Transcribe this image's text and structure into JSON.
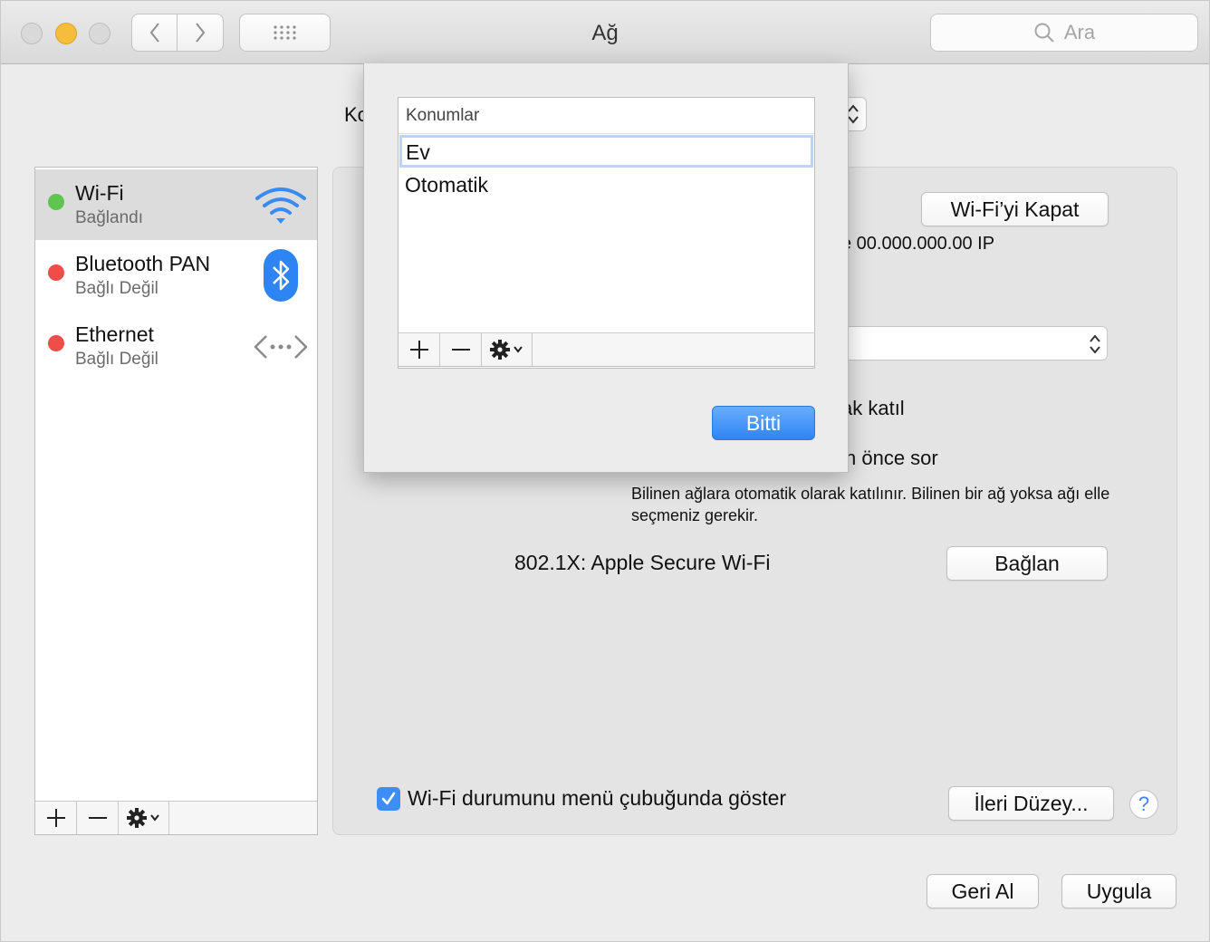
{
  "window": {
    "title": "Ağ"
  },
  "toolbar": {
    "search_placeholder": "Ara"
  },
  "location": {
    "label_visible": "Ko"
  },
  "services": [
    {
      "name": "Wi-Fi",
      "status": "Bağlandı",
      "status_color": "#5fc550",
      "icon": "wifi-icon",
      "selected": true
    },
    {
      "name": "Bluetooth PAN",
      "status": "Bağlı Değil",
      "status_color": "#ee4d49",
      "icon": "bluetooth-icon",
      "selected": false
    },
    {
      "name": "Ethernet",
      "status": "Bağlı Değil",
      "status_color": "#ee4d49",
      "icon": "ethernet-icon",
      "selected": false
    }
  ],
  "panel": {
    "wifi_off_button": "Wi-Fi’yi Kapat",
    "ip_text": "e 00.000.000.00 IP",
    "auto_join_fragment": "ak katıl",
    "ask_fragment": "n önce sor",
    "description": "Bilinen ağlara otomatik olarak katılınır. Bilinen bir ağ yoksa ağı elle seçmeniz gerekir.",
    "dot1x_label": "802.1X:  Apple Secure Wi-Fi",
    "connect_button": "Bağlan",
    "show_status_label": "Wi-Fi durumunu menü çubuğunda göster",
    "show_status_checked": true,
    "advanced_button": "İleri Düzey...",
    "help": "?"
  },
  "footer": {
    "revert_button": "Geri Al",
    "apply_button": "Uygula"
  },
  "sheet": {
    "header": "Konumlar",
    "locations": [
      "Ev",
      "Otomatik"
    ],
    "selected_location": "Ev",
    "done_button": "Bitti"
  },
  "accent_color": "#3c8ef6"
}
